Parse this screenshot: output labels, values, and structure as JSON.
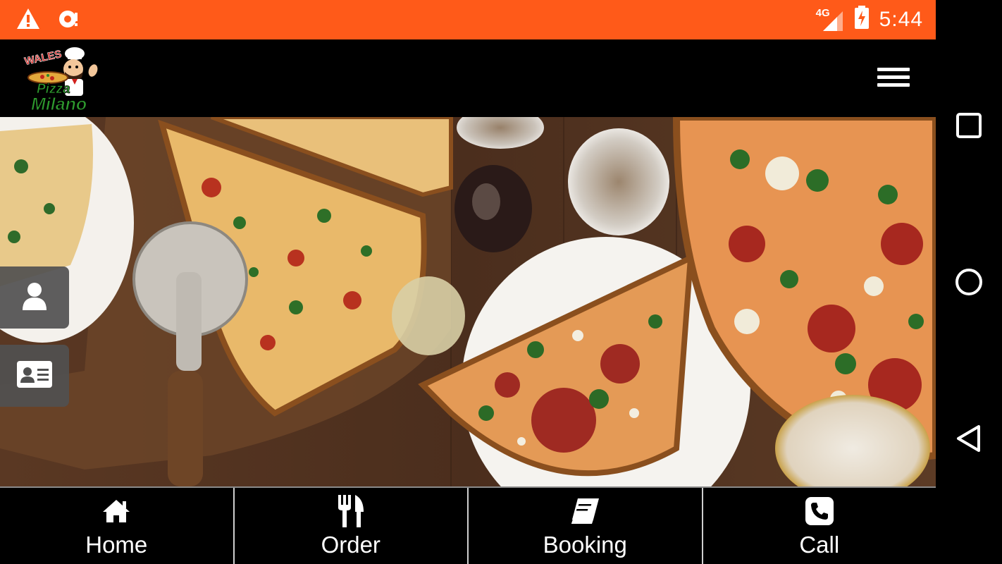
{
  "status_bar": {
    "time": "5:44",
    "network": "4G",
    "icons": [
      "warning-icon",
      "notification-icon",
      "signal-icon",
      "battery-charging-icon"
    ],
    "bg_color": "#ff5a19"
  },
  "header": {
    "logo_top": "WALES",
    "logo_mid": "Pizza",
    "logo_bottom": "Milano",
    "menu_icon": "hamburger-menu-icon"
  },
  "side_buttons": [
    {
      "icon": "user-icon"
    },
    {
      "icon": "contact-card-icon"
    }
  ],
  "bottom_nav": [
    {
      "label": "Home",
      "icon": "home-icon"
    },
    {
      "label": "Order",
      "icon": "fork-knife-icon"
    },
    {
      "label": "Booking",
      "icon": "book-icon"
    },
    {
      "label": "Call",
      "icon": "phone-icon"
    }
  ],
  "android_nav": [
    "recents-icon",
    "home-circle-icon",
    "back-icon"
  ]
}
